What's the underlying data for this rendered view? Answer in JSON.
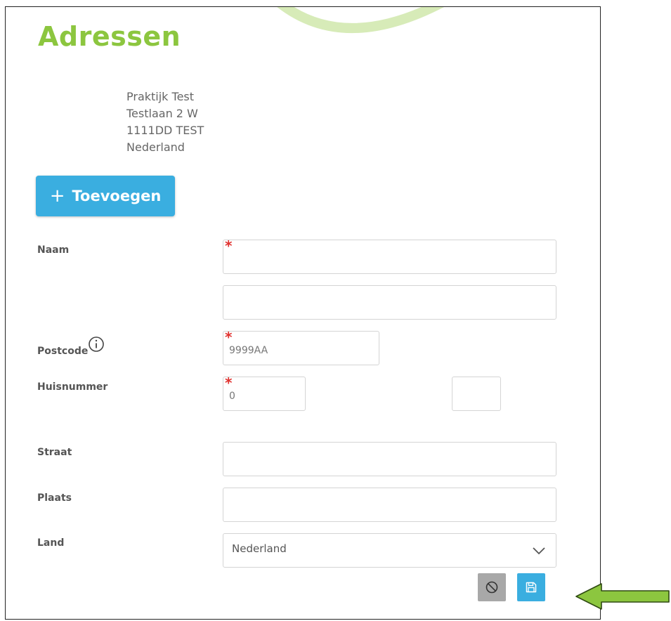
{
  "page": {
    "title": "Adressen"
  },
  "address": {
    "lines": [
      "Praktijk Test",
      "Testlaan 2 W",
      "1111DD TEST",
      "Nederland"
    ]
  },
  "toolbar": {
    "add_label": "Toevoegen",
    "add_icon": "plus-icon"
  },
  "form": {
    "naam": {
      "label": "Naam",
      "value": "",
      "value2": "",
      "required": true
    },
    "postcode": {
      "label": "Postcode",
      "value": "9999AA",
      "required": true,
      "icon": "info-icon"
    },
    "huisnummer": {
      "label": "Huisnummer",
      "value": "0",
      "toevoeging": "",
      "required": true
    },
    "straat": {
      "label": "Straat",
      "value": ""
    },
    "plaats": {
      "label": "Plaats",
      "value": ""
    },
    "land": {
      "label": "Land",
      "value": "Nederland",
      "icon": "chevron-down-icon"
    },
    "required_marker": "*"
  },
  "actions": {
    "cancel_icon": "ban-icon",
    "save_icon": "floppy-disk-icon"
  },
  "colors": {
    "title": "#8cc63f",
    "primary": "#3aaee0",
    "cancel": "#a8a8a8",
    "required": "#e0312e",
    "arrow": "#8cc63f"
  }
}
